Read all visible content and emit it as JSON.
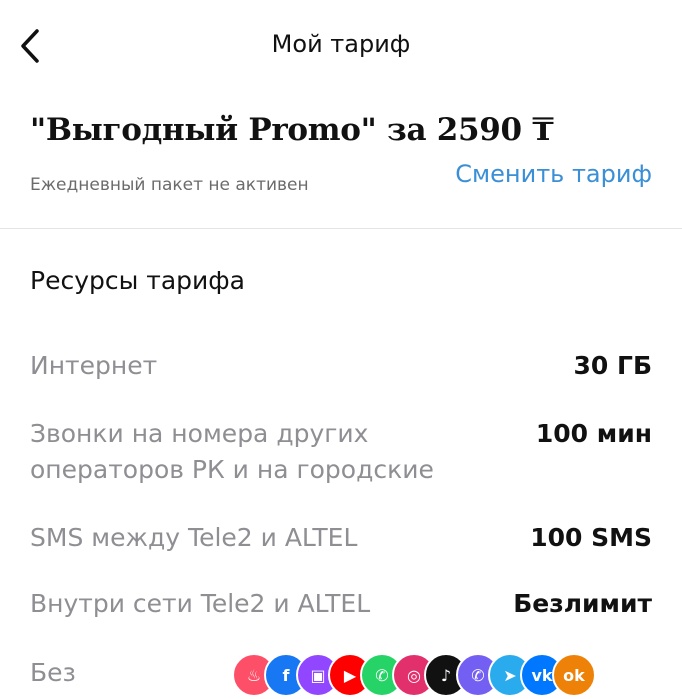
{
  "header": {
    "title": "Мой тариф",
    "back_icon": "chevron-left-icon"
  },
  "tariff": {
    "title": "\"Выгодный Promo\" за 2590 ₸",
    "daily_status": "Ежедневный пакет не активен",
    "change_link": "Сменить тариф",
    "accent_color": "#3a8fd6"
  },
  "resources": {
    "title": "Ресурсы тарифа",
    "items": [
      {
        "label": "Интернет",
        "value": "30 ГБ"
      },
      {
        "label_line1": "Звонки на номера других",
        "label_line2": "операторов РК и на городские",
        "value": "100 мин"
      },
      {
        "label": "SMS между Tele2 и ALTEL",
        "value": "100 SMS"
      },
      {
        "label": "Внутри сети Tele2 и ALTEL",
        "value": "Безлимит"
      },
      {
        "label": "Без"
      }
    ]
  },
  "social_apps": [
    {
      "name": "tinder-icon",
      "color": "#fd5068",
      "glyph": "♨"
    },
    {
      "name": "facebook-icon",
      "color": "#1877f2",
      "glyph": "f"
    },
    {
      "name": "twitch-icon",
      "color": "#9146ff",
      "glyph": "▣"
    },
    {
      "name": "youtube-icon",
      "color": "#ff0000",
      "glyph": "▶"
    },
    {
      "name": "whatsapp-icon",
      "color": "#25d366",
      "glyph": "✆"
    },
    {
      "name": "instagram-icon",
      "color": "#e1306c",
      "glyph": "◎"
    },
    {
      "name": "tiktok-icon",
      "color": "#111111",
      "glyph": "♪"
    },
    {
      "name": "viber-icon",
      "color": "#7360f2",
      "glyph": "✆"
    },
    {
      "name": "telegram-icon",
      "color": "#2aabee",
      "glyph": "➤"
    },
    {
      "name": "vk-icon",
      "color": "#0077ff",
      "glyph": "vk"
    },
    {
      "name": "odnoklassniki-icon",
      "color": "#ee8208",
      "glyph": "ok"
    }
  ]
}
